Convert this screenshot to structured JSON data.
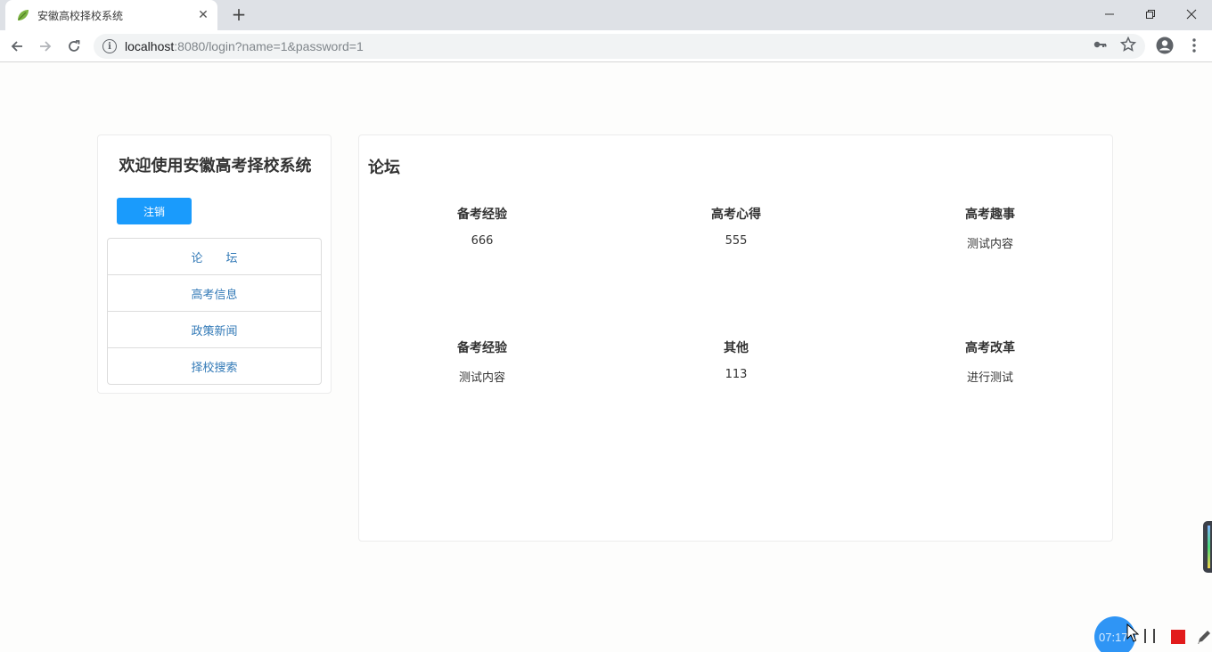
{
  "browser": {
    "tab_title": "安徽高校择校系统",
    "tab_close": "✕",
    "new_tab": "+",
    "url_host": "localhost",
    "url_rest": ":8080/login?name=1&password=1",
    "info_glyph": "i",
    "icons": [
      "leaf-favicon-icon",
      "back-arrow-icon",
      "forward-arrow-icon",
      "reload-icon",
      "info-icon",
      "key-icon",
      "star-icon",
      "profile-icon",
      "menu-dots-icon"
    ]
  },
  "sidebar": {
    "welcome": "欢迎使用安徽高考择校系统",
    "logout_label": "注销",
    "items": [
      {
        "label": "论坛"
      },
      {
        "label": "高考信息"
      },
      {
        "label": "政策新闻"
      },
      {
        "label": "择校搜索"
      }
    ]
  },
  "forum": {
    "title": "论坛",
    "posts": [
      {
        "title": "备考经验",
        "content": "666"
      },
      {
        "title": "高考心得",
        "content": "555"
      },
      {
        "title": "高考趣事",
        "content": "测试内容"
      },
      {
        "title": "备考经验",
        "content": "测试内容"
      },
      {
        "title": "其他",
        "content": "113"
      },
      {
        "title": "高考改革",
        "content": "进行测试"
      }
    ]
  },
  "recorder": {
    "timer": "07:17"
  },
  "colors": {
    "primary_button": "#1a9bfc",
    "link": "#337ab7",
    "recorder_timer": "#2f95f5",
    "recorder_stop": "#e21b1b"
  }
}
